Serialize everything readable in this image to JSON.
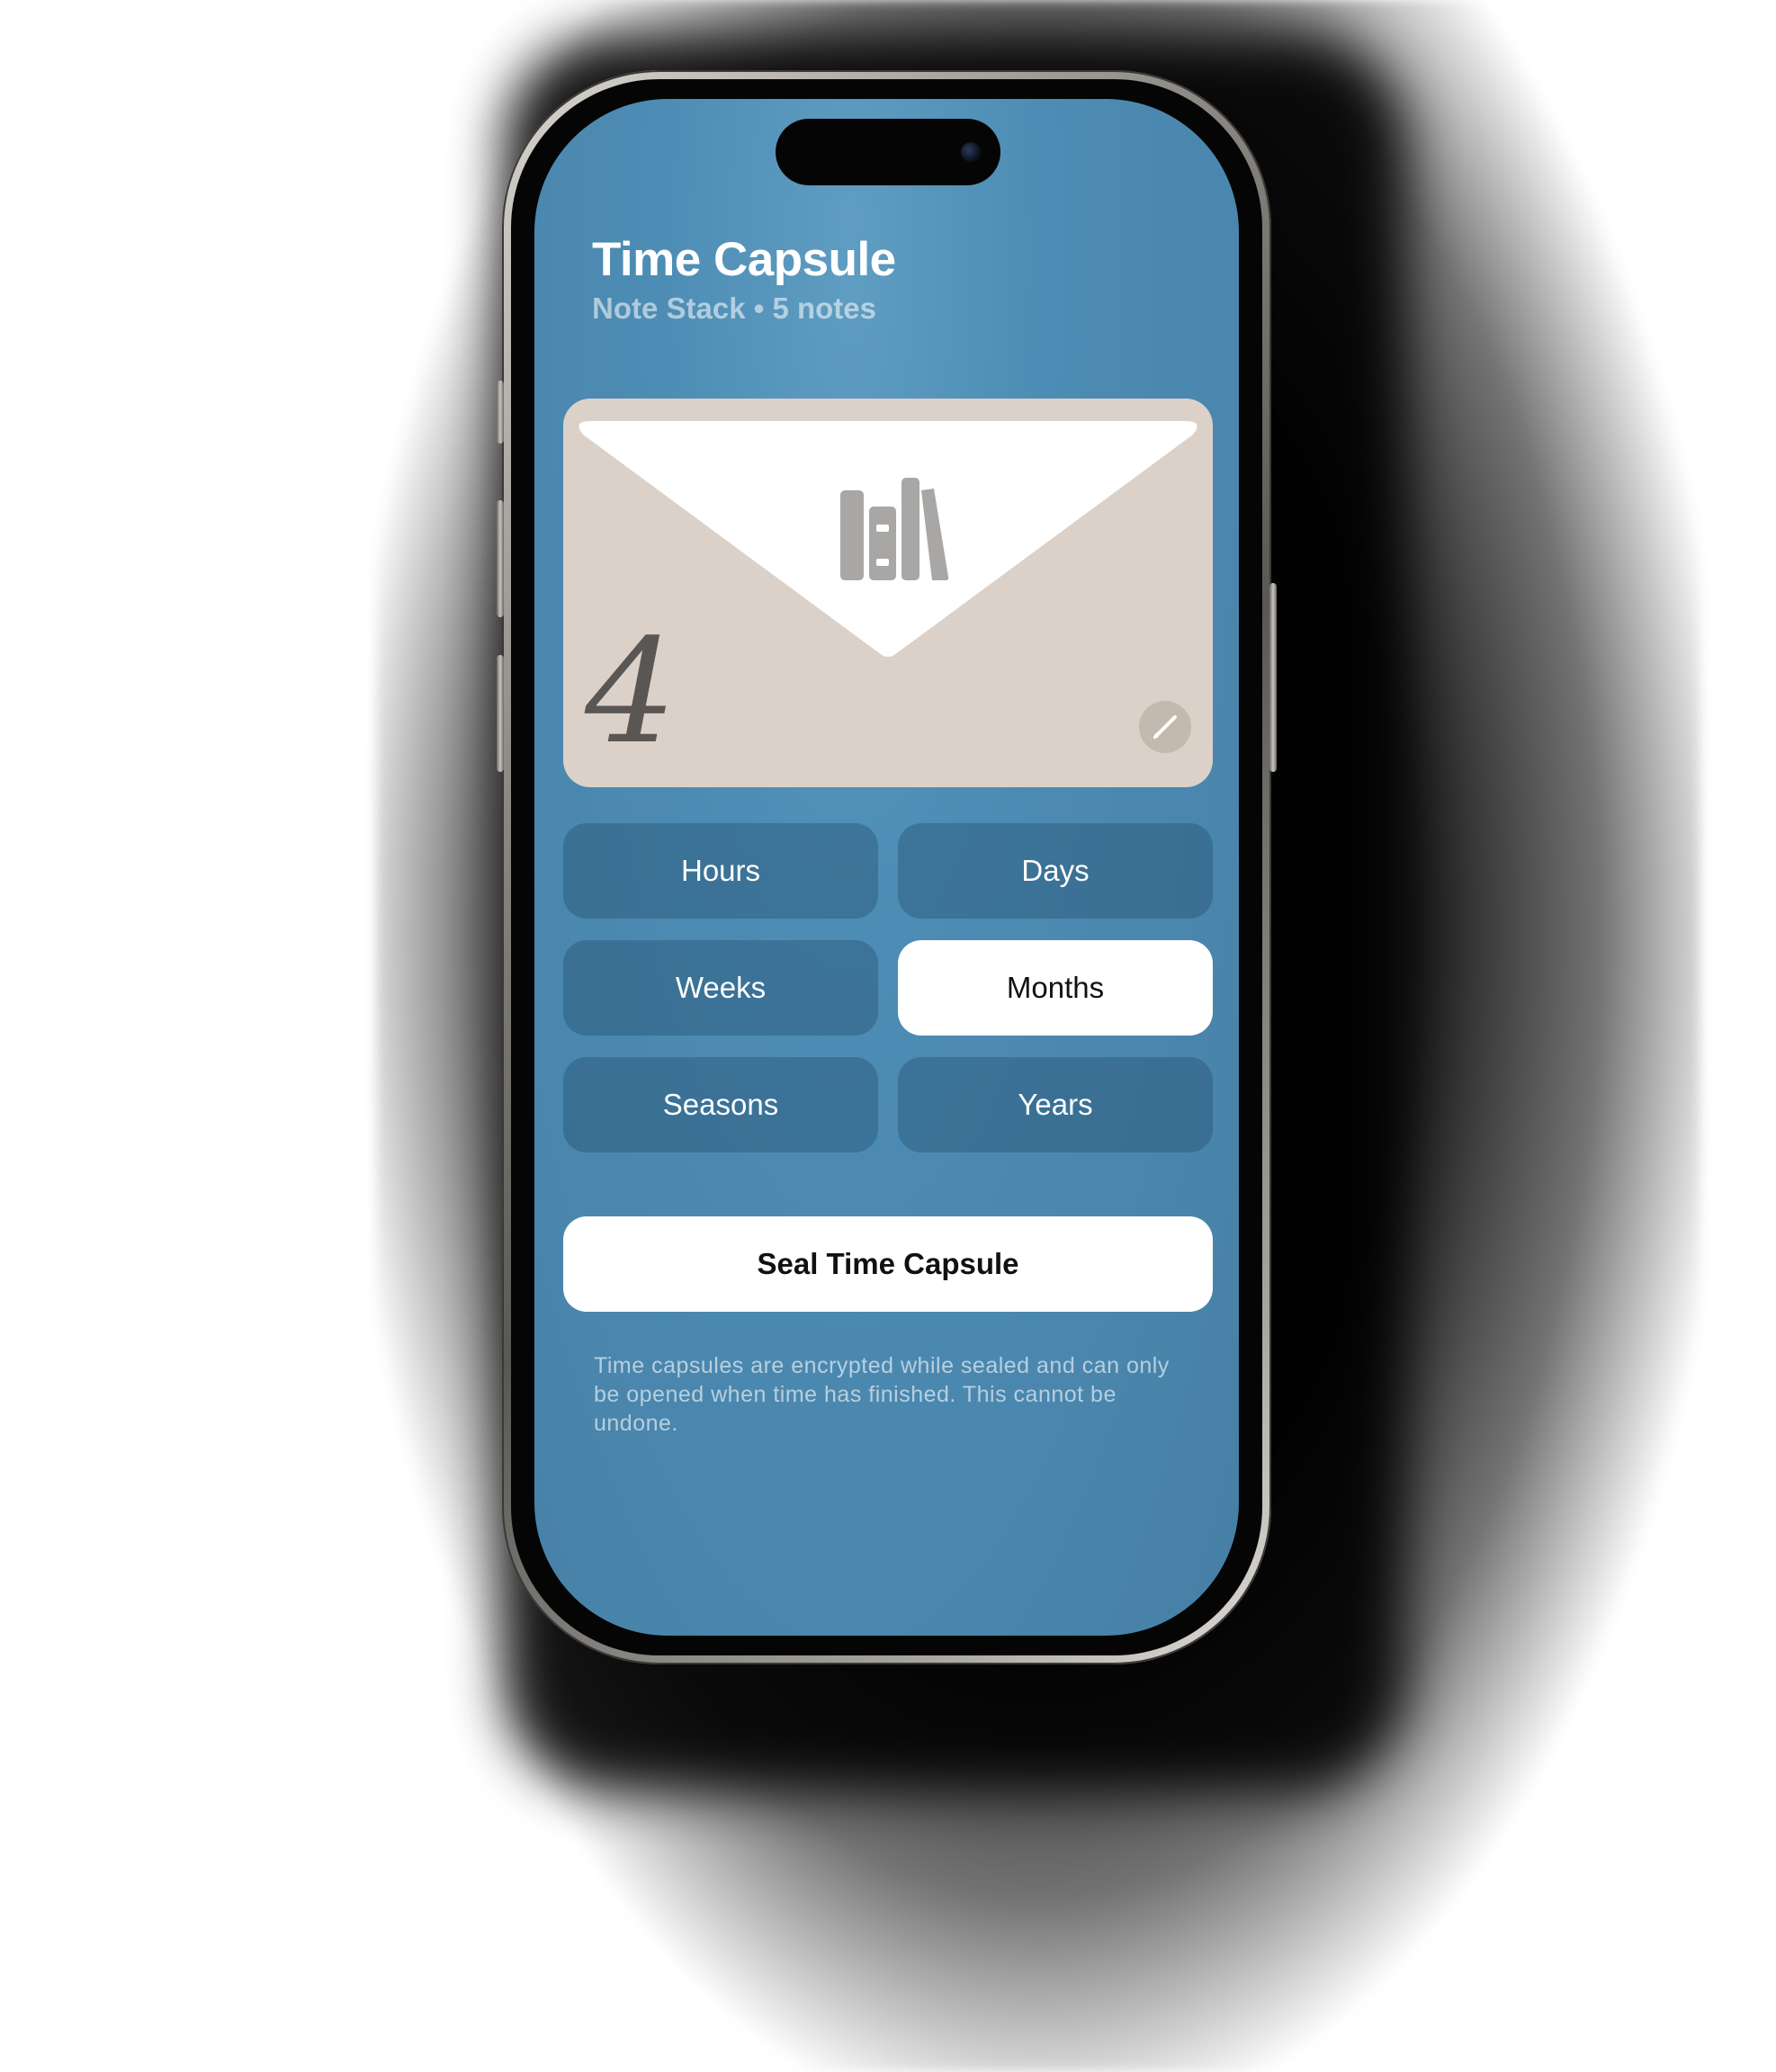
{
  "header": {
    "title": "Time Capsule",
    "subtitle": "Note Stack • 5 notes"
  },
  "card": {
    "number": "4",
    "icon": "books-icon",
    "edit_icon": "pencil-icon",
    "color": "#dbd1c8"
  },
  "options": [
    {
      "label": "Hours",
      "selected": false
    },
    {
      "label": "Days",
      "selected": false
    },
    {
      "label": "Weeks",
      "selected": false
    },
    {
      "label": "Months",
      "selected": true
    },
    {
      "label": "Seasons",
      "selected": false
    },
    {
      "label": "Years",
      "selected": false
    }
  ],
  "seal_button": {
    "label": "Seal Time Capsule"
  },
  "footnote": "Time capsules are encrypted while sealed and can only be opened when time has finished. This cannot be undone.",
  "colors": {
    "screen_background": "#4d8cb4",
    "selected_option": "#ffffff",
    "unselected_option": "#2e5f82"
  }
}
